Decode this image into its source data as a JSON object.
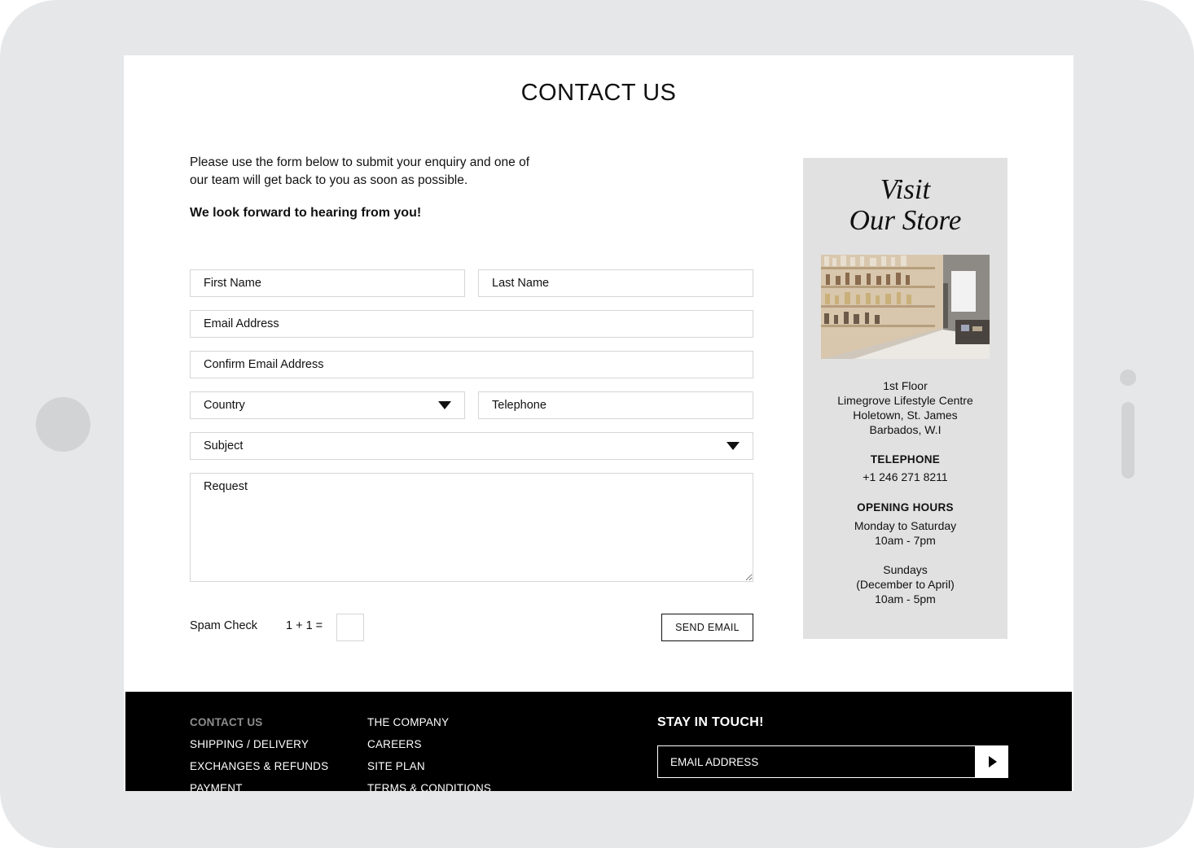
{
  "page": {
    "title": "CONTACT US",
    "intro": "Please use the form below to submit your enquiry and one of our team will get back to you as soon as possible.",
    "intro_bold": "We look forward to hearing from you!"
  },
  "form": {
    "first_name_placeholder": "First Name",
    "last_name_placeholder": "Last Name",
    "email_placeholder": "Email Address",
    "confirm_email_placeholder": "Confirm Email Address",
    "country_label": "Country",
    "telephone_placeholder": "Telephone",
    "subject_label": "Subject",
    "request_placeholder": "Request",
    "spam_label": "Spam Check",
    "spam_question": "1 + 1 =",
    "send_label": "SEND EMAIL"
  },
  "store": {
    "heading_line1": "Visit",
    "heading_line2": "Our Store",
    "address": [
      "1st Floor",
      "Limegrove Lifestyle Centre",
      "Holetown, St. James",
      "Barbados, W.I"
    ],
    "telephone_label": "TELEPHONE",
    "telephone": "+1 246 271 8211",
    "hours_label": "OPENING HOURS",
    "hours_weekday": [
      "Monday to Saturday",
      "10am - 7pm"
    ],
    "hours_sunday": [
      "Sundays",
      "(December to April)",
      "10am - 5pm"
    ]
  },
  "footer": {
    "col1": [
      "CONTACT US",
      "SHIPPING / DELIVERY",
      "EXCHANGES & REFUNDS",
      "PAYMENT"
    ],
    "col2": [
      "THE COMPANY",
      "CAREERS",
      "SITE PLAN",
      "TERMS & CONDITIONS"
    ],
    "stay_title": "STAY IN TOUCH!",
    "email_placeholder": "EMAIL ADDRESS",
    "active_item": "CONTACT US"
  },
  "colors": {
    "device_frame": "#e6e7e8",
    "store_panel": "#e1e1e1",
    "footer_bg": "#000000",
    "footer_active": "#8d8d8d"
  },
  "icons": {
    "select_caret": "caret-down-icon",
    "newsletter_submit": "play-arrow-icon",
    "textarea_resize": "resize-grip-icon"
  }
}
